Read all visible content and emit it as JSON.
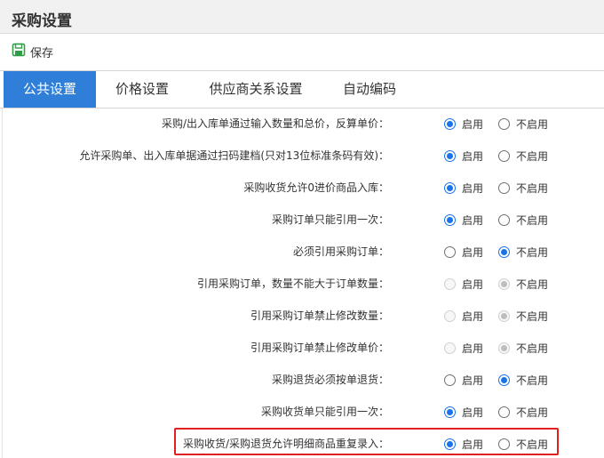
{
  "page": {
    "title": "采购设置"
  },
  "toolbar": {
    "save_label": "保存"
  },
  "tabs": [
    {
      "label": "公共设置",
      "active": true
    },
    {
      "label": "价格设置",
      "active": false
    },
    {
      "label": "供应商关系设置",
      "active": false
    },
    {
      "label": "自动编码",
      "active": false
    }
  ],
  "options": {
    "enable": "启用",
    "disable": "不启用"
  },
  "settings": [
    {
      "label": "采购/出入库单通过输入数量和总价，反算单价：",
      "value": "enable",
      "disabled": false
    },
    {
      "label": "允许采购单、出入库单据通过扫码建档(只对13位标准条码有效)：",
      "value": "enable",
      "disabled": false
    },
    {
      "label": "采购收货允许0进价商品入库：",
      "value": "enable",
      "disabled": false
    },
    {
      "label": "采购订单只能引用一次：",
      "value": "enable",
      "disabled": false
    },
    {
      "label": "必须引用采购订单：",
      "value": "disable",
      "disabled": false
    },
    {
      "label": "引用采购订单，数量不能大于订单数量：",
      "value": "disable",
      "disabled": true
    },
    {
      "label": "引用采购订单禁止修改数量：",
      "value": "disable",
      "disabled": true
    },
    {
      "label": "引用采购订单禁止修改单价：",
      "value": "disable",
      "disabled": true
    },
    {
      "label": "采购退货必须按单退货：",
      "value": "disable",
      "disabled": false
    },
    {
      "label": "采购收货单只能引用一次：",
      "value": "enable",
      "disabled": false
    },
    {
      "label": "采购收货/采购退货允许明细商品重复录入：",
      "value": "enable",
      "disabled": false
    }
  ],
  "colors": {
    "accent": "#2f7fd8",
    "radio": "#1a73e8",
    "highlight": "#e02020",
    "save_icon": "#2e9e44"
  },
  "icons": {
    "save": "save-icon"
  }
}
